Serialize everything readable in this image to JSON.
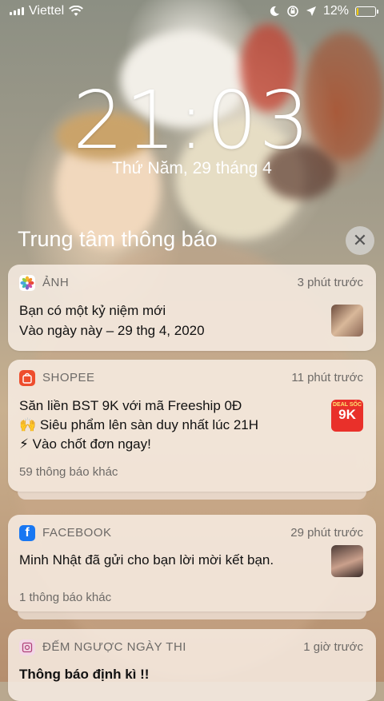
{
  "status": {
    "carrier": "Viettel",
    "battery_percent": "12%",
    "battery_level": 0.12,
    "icons": [
      "signal-icon",
      "wifi-icon",
      "moon-icon",
      "rotation-lock-icon",
      "location-icon",
      "battery-icon"
    ]
  },
  "lockscreen": {
    "time": "21:03",
    "date": "Thứ Năm, 29 tháng 4"
  },
  "notification_center": {
    "title": "Trung tâm thông báo",
    "close_icon": "close-icon"
  },
  "notifications": [
    {
      "app": "ẢNH",
      "icon": "photos-icon",
      "time": "3 phút trước",
      "title": "Bạn có một kỷ niệm mới",
      "body": "Vào ngày này – 29 thg 4, 2020"
    },
    {
      "app": "SHOPEE",
      "icon": "shopee-icon",
      "time": "11 phút trước",
      "title": "Săn liền BST 9K với mã Freeship 0Đ",
      "body_line1": "🙌 Siêu phẩm lên sàn duy nhất lúc 21H",
      "body_line2": "⚡ Vào chốt đơn ngay!",
      "more": "59 thông báo khác",
      "thumb_text_top": "DEAL SỐC",
      "thumb_text_big": "9K"
    },
    {
      "app": "FACEBOOK",
      "icon": "facebook-icon",
      "time": "29 phút trước",
      "body": "Minh Nhật đã gửi cho bạn lời mời kết bạn.",
      "more": "1 thông báo khác"
    },
    {
      "app": "ĐẾM NGƯỢC NGÀY THI",
      "icon": "countdown-icon",
      "time": "1 giờ trước",
      "title": "Thông báo định kì !!"
    }
  ]
}
